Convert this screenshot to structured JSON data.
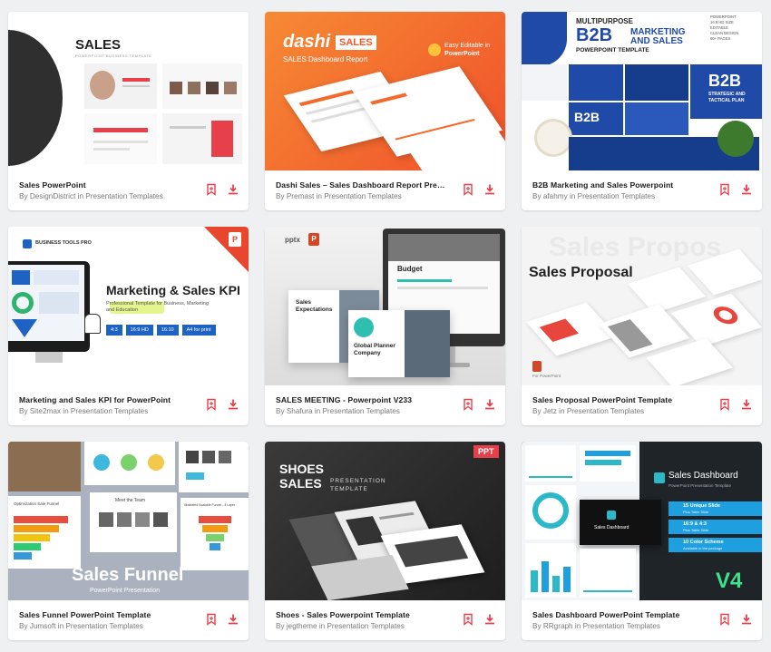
{
  "cards": [
    {
      "title": "Sales PowerPoint",
      "author": "DesignDistrict",
      "category": "Presentation Templates",
      "thumb": {
        "heading": "SALES",
        "sub": "POWERPOINT BUSINESS TEMPLATE",
        "colors": [
          "#e8404b",
          "#333333",
          "#ffffff"
        ]
      }
    },
    {
      "title": "Dashi Sales – Sales Dashboard Report Presentation",
      "author": "Premast",
      "category": "Presentation Templates",
      "thumb": {
        "brand": "dashi",
        "badge": "SALES",
        "sub": "SALES Dashboard Report",
        "note": "Easy Editable in",
        "note2": "PowerPoint",
        "colors": [
          "#f46a2b",
          "#ff8a3d"
        ]
      }
    },
    {
      "title": "B2B Marketing and Sales Powerpoint",
      "author": "afahmy",
      "category": "Presentation Templates",
      "thumb": {
        "line1": "MULTIPURPOSE",
        "line2": "B2B",
        "line3": "MARKETING",
        "line4": "AND SALES",
        "line5": "POWERPOINT TEMPLATE",
        "features": [
          "POWERPOINT",
          "16:9 HD SIZE",
          "EDITABLE",
          "CLEAN DESIGN",
          "60+ PAGES"
        ],
        "big": "B2B",
        "big_sub": "STRATEGIC AND TACTICAL PLAN",
        "colors": [
          "#1f4aa8",
          "#0e2c6e"
        ]
      }
    },
    {
      "title": "Marketing and Sales KPI for PowerPoint",
      "author": "Site2max",
      "category": "Presentation Templates",
      "thumb": {
        "brand": "BUSINESS TOOLS PRO",
        "heading": "Marketing & Sales KPI",
        "sub": "Professional Template for Business, Marketing and Education",
        "tags": [
          "4:3",
          "16:9 HD",
          "16:10",
          "A4 for print"
        ],
        "colors": [
          "#1e63c4",
          "#e8472f"
        ]
      }
    },
    {
      "title": "SALES MEETING - Powerpoint V233",
      "author": "Shafura",
      "category": "Presentation Templates",
      "thumb": {
        "format": "pptx",
        "s1": "Budget",
        "s2": "Sales Expectations",
        "s3": "Global Planner Company",
        "colors": [
          "#2fbfb0",
          "#d9d9d9"
        ]
      }
    },
    {
      "title": "Sales Proposal PowerPoint Template",
      "author": "Jetz",
      "category": "Presentation Templates",
      "thumb": {
        "ghost": "Sales Propos",
        "heading": "Sales Proposal",
        "note": "For PowerPoint",
        "colors": [
          "#e8453c"
        ]
      }
    },
    {
      "title": "Sales Funnel PowerPoint Template",
      "author": "Jumsoft",
      "category": "Presentation Templates",
      "thumb": {
        "heading": "Sales Funnel",
        "sub": "PowerPoint Presentation",
        "s1": "Optimization Sale Funnel",
        "s2": "Meet the Team",
        "s3": "Illustrated Scalable Funnel - 4 Layer",
        "colors": [
          "#9ba6b5"
        ]
      }
    },
    {
      "title": "Shoes - Sales Powerpoint Template",
      "author": "jegtheme",
      "category": "Presentation Templates",
      "thumb": {
        "l1": "SHOES",
        "l2": "SALES",
        "sub1": "PRESENTATION",
        "sub2": "TEMPLATE",
        "format": "PPT",
        "colors": [
          "#2b2b2b",
          "#e8404b"
        ]
      }
    },
    {
      "title": "Sales Dashboard PowerPoint Template",
      "author": "RRgraph",
      "category": "Presentation Templates",
      "thumb": {
        "heading": "Sales Dashboard",
        "sub": "PowerPoint Presentation Template",
        "f1": "15 Unique Slide",
        "f1s": "Plus Table Slide",
        "f2": "16:9 & 4:3",
        "f2s": "Plus Table Slide",
        "f3": "10 Color Scheme",
        "f3s": "Available in the package",
        "version": "V4",
        "mini": "Sales Dashboard",
        "colors": [
          "#2bb8c9",
          "#1d9fe0",
          "#3de38a"
        ]
      }
    }
  ],
  "labels": {
    "by": "By",
    "in": "in"
  }
}
